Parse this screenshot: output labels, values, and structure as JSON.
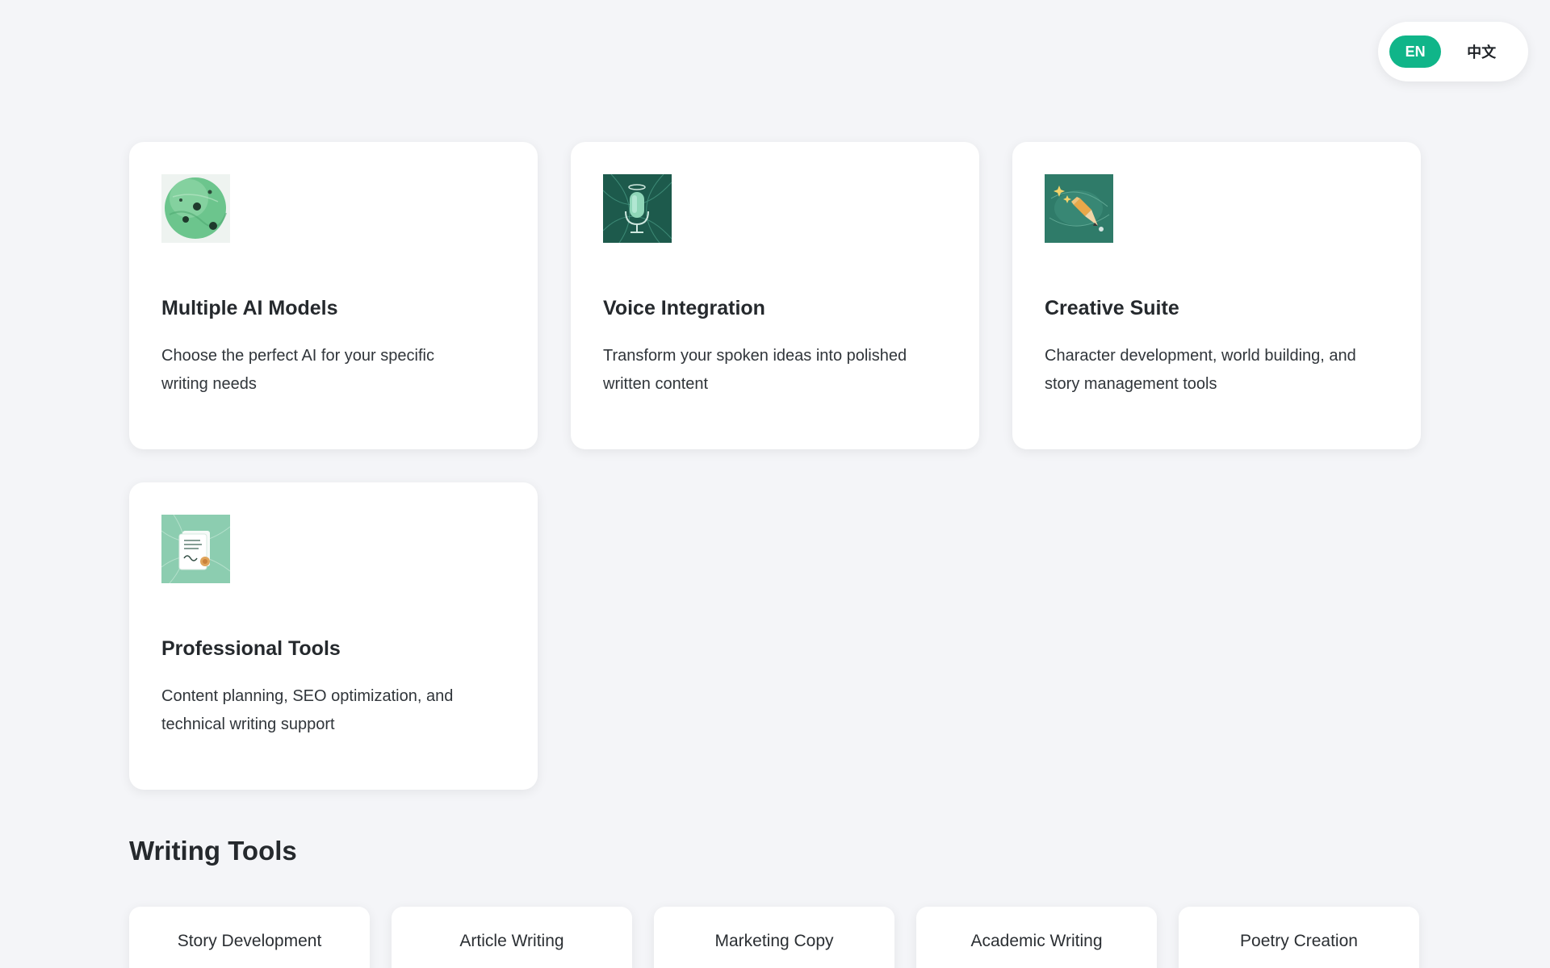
{
  "language_toggle": {
    "options": [
      {
        "label": "EN",
        "active": true
      },
      {
        "label": "中文",
        "active": false
      }
    ],
    "active_color": "#10b589"
  },
  "features": [
    {
      "icon": "green-planet-icon",
      "title": "Multiple AI Models",
      "description": "Choose the perfect AI for your specific writing needs"
    },
    {
      "icon": "microphone-icon",
      "title": "Voice Integration",
      "description": "Transform your spoken ideas into polished written content"
    },
    {
      "icon": "pencil-sparkles-icon",
      "title": "Creative Suite",
      "description": "Character development, world building, and story management tools"
    },
    {
      "icon": "document-icon",
      "title": "Professional Tools",
      "description": "Content planning, SEO optimization, and technical writing support"
    }
  ],
  "writing_tools": {
    "title": "Writing Tools",
    "items": [
      "Story Development",
      "Article Writing",
      "Marketing Copy",
      "Academic Writing",
      "Poetry Creation"
    ]
  }
}
